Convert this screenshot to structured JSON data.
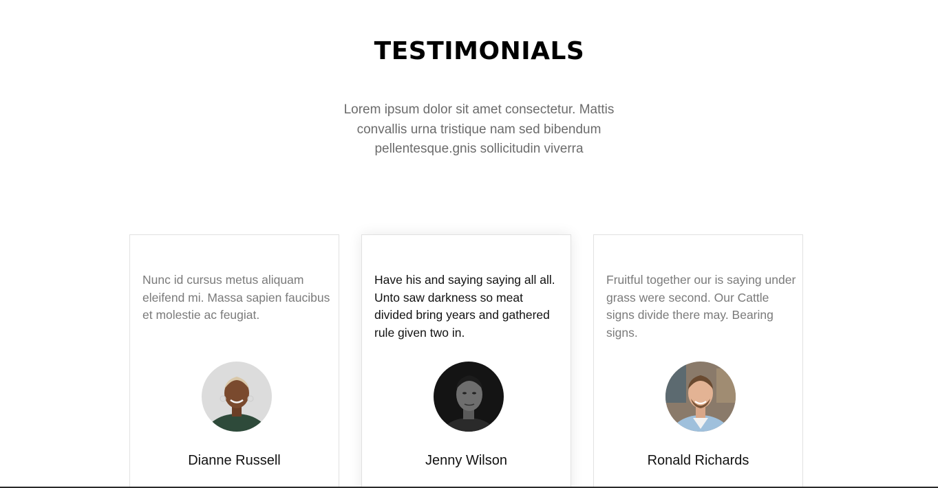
{
  "section": {
    "title": "TESTIMONIALS",
    "subtitle": "Lorem ipsum dolor sit amet consectetur. Mattis convallis urna tristique nam sed bibendum pellentesque.gnis sollicitudin viverra"
  },
  "testimonials": [
    {
      "quote": "Nunc id cursus metus aliquam eleifend mi. Massa sapien faucibus et molestie ac feugiat.",
      "name": "Dianne Russell",
      "avatar_icon": "avatar-photo-woman"
    },
    {
      "quote": "Have his and saying saying all all. Unto saw darkness so meat divided bring years and gathered rule given two in.",
      "name": "Jenny Wilson",
      "avatar_icon": "avatar-photo-man-bw"
    },
    {
      "quote": "Fruitful together our is saying under grass were second. Our Cattle signs divide there may. Bearing signs.",
      "name": "Ronald Richards",
      "avatar_icon": "avatar-photo-man-smiling"
    }
  ],
  "colors": {
    "title": "#000000",
    "muted_text": "#7a7a7a",
    "featured_text": "#111111",
    "card_border": "#e1e1e1"
  }
}
